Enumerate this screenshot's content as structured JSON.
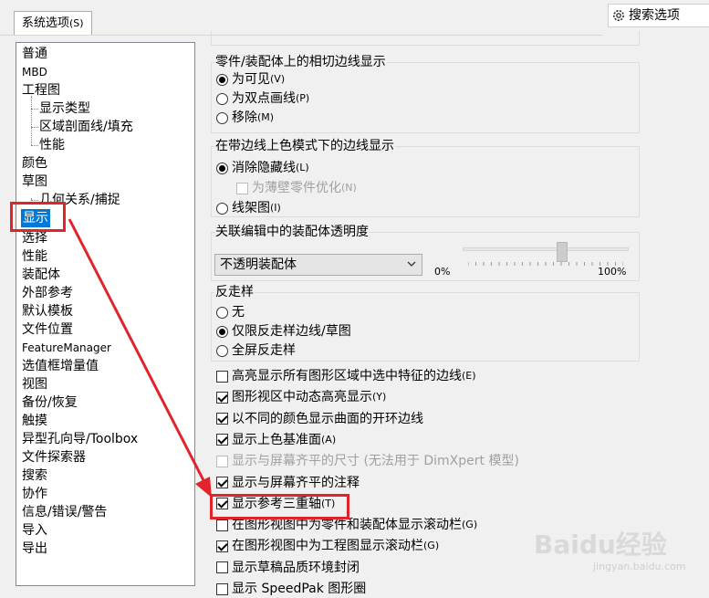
{
  "tab": {
    "label": "系统选项",
    "key": "(S)"
  },
  "search": {
    "label": "搜索选项"
  },
  "nav": {
    "items": [
      {
        "label": "普通",
        "level": 0
      },
      {
        "label": "MBD",
        "level": 0,
        "small": true
      },
      {
        "label": "工程图",
        "level": 0
      },
      {
        "label": "显示类型",
        "level": 1
      },
      {
        "label": "区域剖面线/填充",
        "level": 1
      },
      {
        "label": "性能",
        "level": 1
      },
      {
        "label": "颜色",
        "level": 0
      },
      {
        "label": "草图",
        "level": 0
      },
      {
        "label": "几何关系/捕捉",
        "level": 1
      },
      {
        "label": "显示",
        "level": 0,
        "selected": true
      },
      {
        "label": "选择",
        "level": 0
      },
      {
        "label": "性能",
        "level": 0
      },
      {
        "label": "装配体",
        "level": 0
      },
      {
        "label": "外部参考",
        "level": 0
      },
      {
        "label": "默认模板",
        "level": 0
      },
      {
        "label": "文件位置",
        "level": 0
      },
      {
        "label": "FeatureManager",
        "level": 0,
        "small": true
      },
      {
        "label": "选值框增量值",
        "level": 0
      },
      {
        "label": "视图",
        "level": 0
      },
      {
        "label": "备份/恢复",
        "level": 0
      },
      {
        "label": "触摸",
        "level": 0
      },
      {
        "label": "异型孔向导/Toolbox",
        "level": 0
      },
      {
        "label": "文件探索器",
        "level": 0
      },
      {
        "label": "搜索",
        "level": 0
      },
      {
        "label": "协作",
        "level": 0
      },
      {
        "label": "信息/错误/警告",
        "level": 0
      },
      {
        "label": "导入",
        "level": 0
      },
      {
        "label": "导出",
        "level": 0
      }
    ]
  },
  "groups": {
    "tangent": {
      "title": "零件/装配体上的相切边线显示",
      "options": [
        {
          "label": "为可见",
          "key": "(V)",
          "checked": true
        },
        {
          "label": "为双点画线",
          "key": "(P)",
          "checked": false
        },
        {
          "label": "移除",
          "key": "(M)",
          "checked": false
        }
      ]
    },
    "edges": {
      "title": "在带边线上色模式下的边线显示",
      "opt1": {
        "label": "消除隐藏线",
        "key": "(L)",
        "checked": true
      },
      "sub": {
        "label": "为薄壁零件优化",
        "key": "(N)",
        "checked": false,
        "disabled": true
      },
      "opt2": {
        "label": "线架图",
        "key": "(I)",
        "checked": false
      }
    },
    "transparency": {
      "title": "关联编辑中的装配体透明度",
      "select_value": "不透明装配体",
      "min_label": "0%",
      "max_label": "100%",
      "level": 0.6
    },
    "antialias": {
      "title": "反走样",
      "options": [
        {
          "label": "无",
          "key": "",
          "checked": false
        },
        {
          "label": "仅限反走样边线/草图",
          "key": "",
          "checked": true
        },
        {
          "label": "全屏反走样",
          "key": "",
          "checked": false
        }
      ]
    }
  },
  "checks": [
    {
      "label": "高亮显示所有图形区域中选中特征的边线",
      "key": "(E)",
      "checked": false,
      "disabled": false
    },
    {
      "label": "图形视区中动态高亮显示",
      "key": "(Y)",
      "checked": true,
      "disabled": false
    },
    {
      "label": "以不同的颜色显示曲面的开环边线",
      "key": "",
      "checked": true,
      "disabled": false
    },
    {
      "label": "显示上色基准面",
      "key": "(A)",
      "checked": true,
      "disabled": false
    },
    {
      "label": "显示与屏幕齐平的尺寸 (无法用于 DimXpert 模型)",
      "key": "",
      "checked": false,
      "disabled": true
    },
    {
      "label": "显示与屏幕齐平的注释",
      "key": "",
      "checked": true,
      "disabled": false
    },
    {
      "label": "显示参考三重轴",
      "key": "(T)",
      "checked": true,
      "disabled": false
    },
    {
      "label": "在图形视图中为零件和装配体显示滚动栏",
      "key": "(G)",
      "checked": false,
      "disabled": false
    },
    {
      "label": "在图形视图中为工程图显示滚动栏",
      "key": "(G)",
      "checked": true,
      "disabled": false
    },
    {
      "label": "显示草稿品质环境封闭",
      "key": "",
      "checked": false,
      "disabled": false
    },
    {
      "label": "显示 SpeedPak 图形圈",
      "key": "",
      "checked": false,
      "disabled": false
    }
  ],
  "watermark": {
    "brand": "Baidu经验",
    "url": "jingyan.baidu.com"
  },
  "colors": {
    "selection": "#0078d7",
    "annotation": "#e0242a"
  }
}
